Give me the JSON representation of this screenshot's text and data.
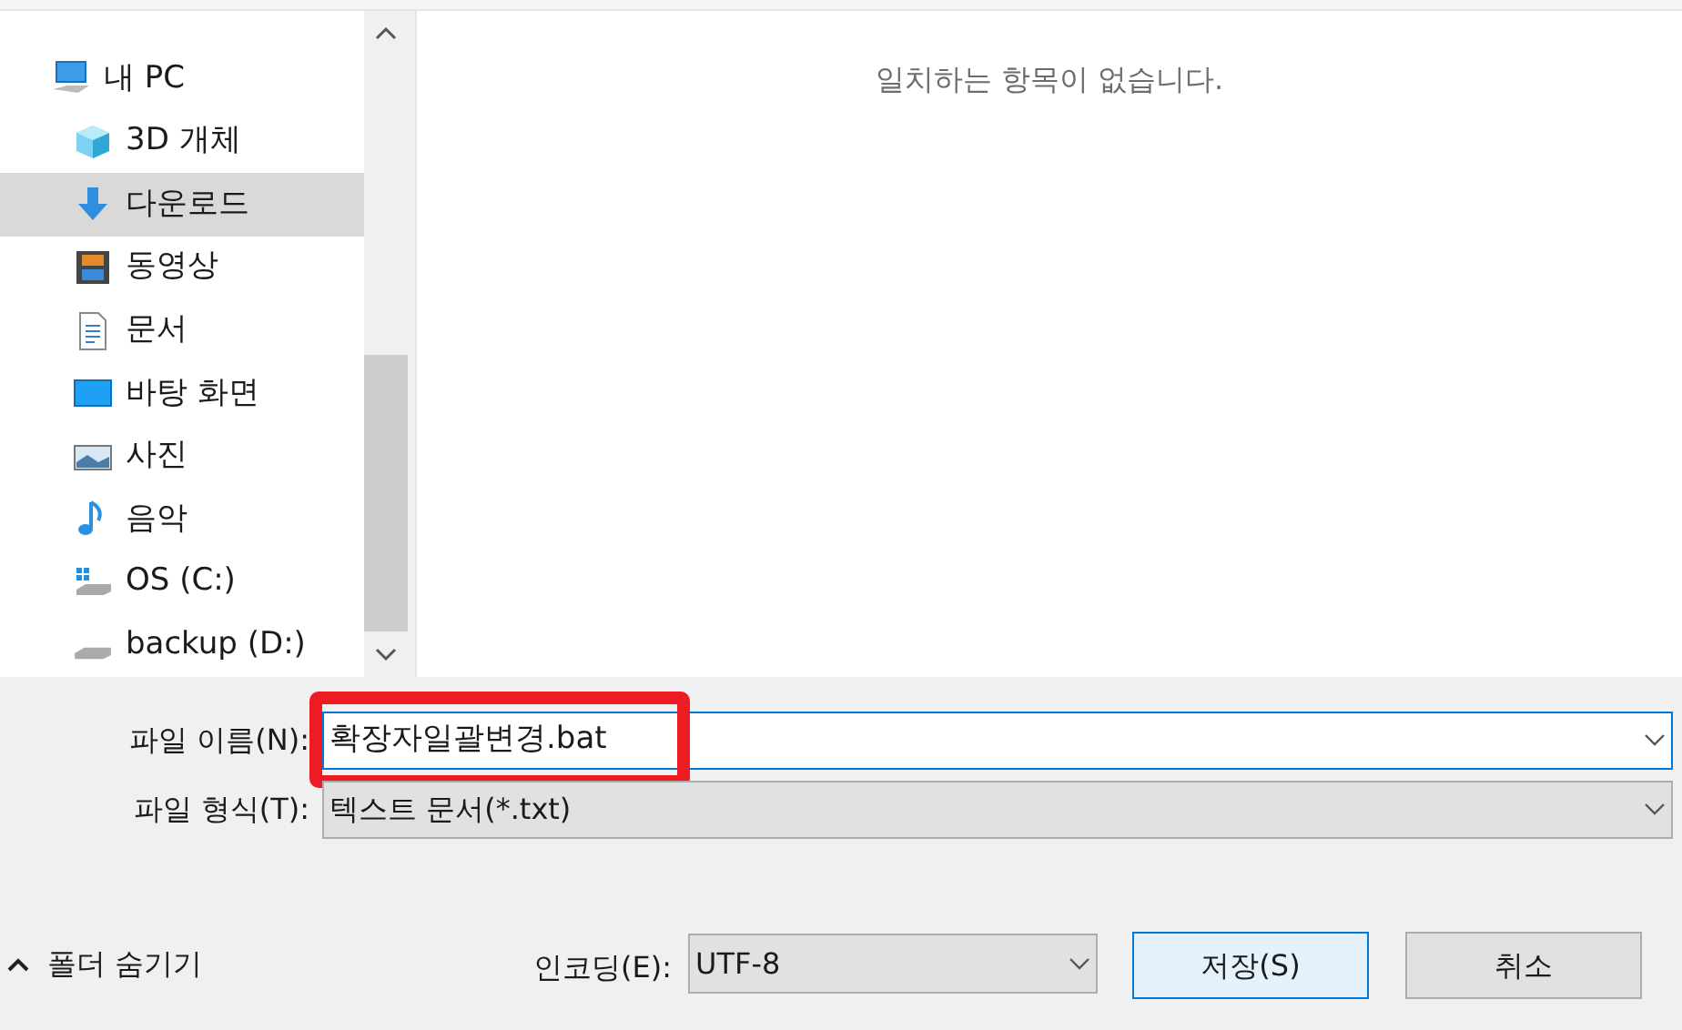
{
  "navigation": {
    "items": [
      {
        "label": "내 PC",
        "kind": "pc",
        "selected": false,
        "children": [
          {
            "label": "3D 개체",
            "kind": "cube",
            "selected": false
          },
          {
            "label": "다운로드",
            "kind": "download",
            "selected": true
          },
          {
            "label": "동영상",
            "kind": "film",
            "selected": false
          },
          {
            "label": "문서",
            "kind": "document",
            "selected": false
          },
          {
            "label": "바탕 화면",
            "kind": "desktop",
            "selected": false
          },
          {
            "label": "사진",
            "kind": "picture",
            "selected": false
          },
          {
            "label": "음악",
            "kind": "music",
            "selected": false
          },
          {
            "label": "OS (C:)",
            "kind": "windows-drive",
            "selected": false
          },
          {
            "label": "backup (D:)",
            "kind": "drive",
            "selected": false
          }
        ]
      }
    ]
  },
  "file_list": {
    "empty_message": "일치하는 항목이 없습니다."
  },
  "file_name": {
    "label": "파일 이름(N):",
    "value": "확장자일괄변경.bat",
    "highlighted": true
  },
  "file_type": {
    "label": "파일 형식(T):",
    "value": "텍스트 문서(*.txt)"
  },
  "folder_toggle": {
    "label": "폴더 숨기기"
  },
  "encoding": {
    "label": "인코딩(E):",
    "value": "UTF-8"
  },
  "buttons": [
    {
      "label": "저장(S)",
      "default": true
    },
    {
      "label": "취소",
      "default": false
    }
  ]
}
